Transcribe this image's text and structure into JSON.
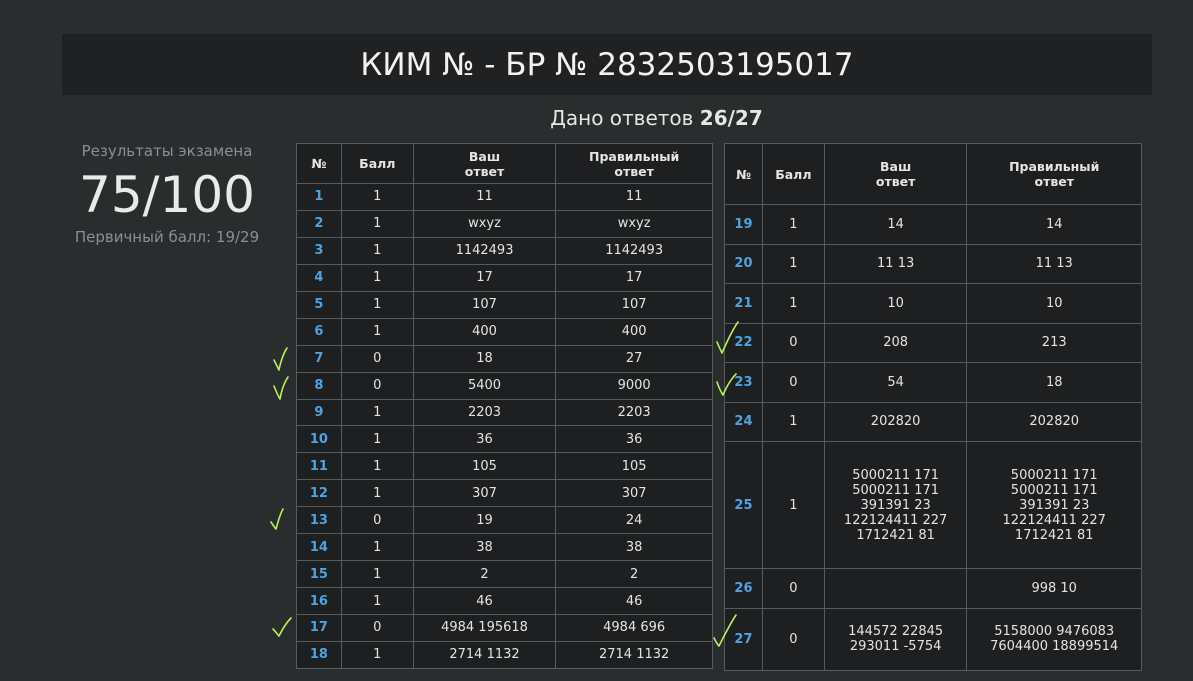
{
  "header": {
    "title": "КИМ № - БР № 2832503195017"
  },
  "answers_given": {
    "label": "Дано ответов",
    "value": "26/27"
  },
  "exam_results": {
    "label": "Результаты экзамена",
    "score": "75/100",
    "primary_score": "Первичный балл: 19/29"
  },
  "table_headers": {
    "num": "№",
    "score": "Балл",
    "your_answer": "Ваш\nответ",
    "correct_answer": "Правильный\nответ"
  },
  "rows_left": [
    {
      "num": "1",
      "score": "1",
      "your": "11",
      "correct": "11"
    },
    {
      "num": "2",
      "score": "1",
      "your": "wxyz",
      "correct": "wxyz"
    },
    {
      "num": "3",
      "score": "1",
      "your": "1142493",
      "correct": "1142493"
    },
    {
      "num": "4",
      "score": "1",
      "your": "17",
      "correct": "17"
    },
    {
      "num": "5",
      "score": "1",
      "your": "107",
      "correct": "107"
    },
    {
      "num": "6",
      "score": "1",
      "your": "400",
      "correct": "400"
    },
    {
      "num": "7",
      "score": "0",
      "your": "18",
      "correct": "27"
    },
    {
      "num": "8",
      "score": "0",
      "your": "5400",
      "correct": "9000"
    },
    {
      "num": "9",
      "score": "1",
      "your": "2203",
      "correct": "2203"
    },
    {
      "num": "10",
      "score": "1",
      "your": "36",
      "correct": "36"
    },
    {
      "num": "11",
      "score": "1",
      "your": "105",
      "correct": "105"
    },
    {
      "num": "12",
      "score": "1",
      "your": "307",
      "correct": "307"
    },
    {
      "num": "13",
      "score": "0",
      "your": "19",
      "correct": "24"
    },
    {
      "num": "14",
      "score": "1",
      "your": "38",
      "correct": "38"
    },
    {
      "num": "15",
      "score": "1",
      "your": "2",
      "correct": "2"
    },
    {
      "num": "16",
      "score": "1",
      "your": "46",
      "correct": "46"
    },
    {
      "num": "17",
      "score": "0",
      "your": "4984 195618",
      "correct": "4984 696"
    },
    {
      "num": "18",
      "score": "1",
      "your": "2714 1132",
      "correct": "2714 1132"
    }
  ],
  "rows_right": [
    {
      "num": "19",
      "score": "1",
      "your": "14",
      "correct": "14"
    },
    {
      "num": "20",
      "score": "1",
      "your": "11 13",
      "correct": "11 13"
    },
    {
      "num": "21",
      "score": "1",
      "your": "10",
      "correct": "10"
    },
    {
      "num": "22",
      "score": "0",
      "your": "208",
      "correct": "213"
    },
    {
      "num": "23",
      "score": "0",
      "your": "54",
      "correct": "18"
    },
    {
      "num": "24",
      "score": "1",
      "your": "202820",
      "correct": "202820"
    },
    {
      "num": "25",
      "score": "1",
      "your": "5000211 171\n5000211 171\n391391 23\n122124411 227\n1712421 81",
      "correct": "5000211 171\n5000211 171\n391391 23\n122124411 227\n1712421 81"
    },
    {
      "num": "26",
      "score": "0",
      "your": "",
      "correct": "998 10"
    },
    {
      "num": "27",
      "score": "0",
      "your": "144572 22845\n293011 -5754",
      "correct": "5158000 9476083\n7604400 18899514"
    }
  ],
  "marks": {
    "check_color": "#b6f25a",
    "number_color": "#4fa3e3"
  }
}
